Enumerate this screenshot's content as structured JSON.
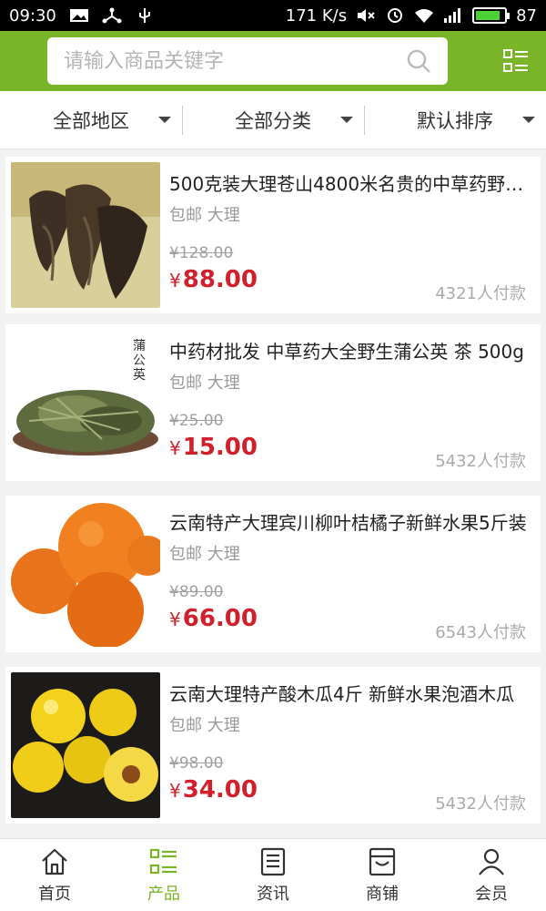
{
  "status": {
    "time": "09:30",
    "speed": "171 K/s",
    "battery": "87"
  },
  "search": {
    "placeholder": "请输入商品关键字"
  },
  "filters": [
    {
      "label": "全部地区"
    },
    {
      "label": "全部分类"
    },
    {
      "label": "默认排序"
    }
  ],
  "products": [
    {
      "title": "500克装大理苍山4800米名贵的中草药野生...",
      "tag": "包邮 大理",
      "old_price": "¥128.00",
      "price": "88.00",
      "sold": "4321人付款",
      "image": "dried-herb"
    },
    {
      "title": "中药材批发 中草药大全野生蒲公英 茶 500g",
      "tag": "包邮 大理",
      "old_price": "¥25.00",
      "price": "15.00",
      "sold": "5432人付款",
      "image": "dandelion-tea",
      "thumb_text": "蒲公英"
    },
    {
      "title": "云南特产大理宾川柳叶桔橘子新鲜水果5斤装",
      "tag": "包邮 大理",
      "old_price": "¥89.00",
      "price": "66.00",
      "sold": "6543人付款",
      "image": "oranges"
    },
    {
      "title": "云南大理特产酸木瓜4斤 新鲜水果泡酒木瓜",
      "tag": "包邮 大理",
      "old_price": "¥98.00",
      "price": "34.00",
      "sold": "5432人付款",
      "image": "quince"
    }
  ],
  "price_symbol": "¥",
  "tabs": [
    {
      "label": "首页",
      "icon": "home-icon"
    },
    {
      "label": "产品",
      "icon": "products-icon",
      "active": true
    },
    {
      "label": "资讯",
      "icon": "news-icon"
    },
    {
      "label": "商铺",
      "icon": "shop-icon"
    },
    {
      "label": "会员",
      "icon": "member-icon"
    }
  ],
  "colors": {
    "brand": "#7ab529",
    "price": "#d11f2b"
  }
}
